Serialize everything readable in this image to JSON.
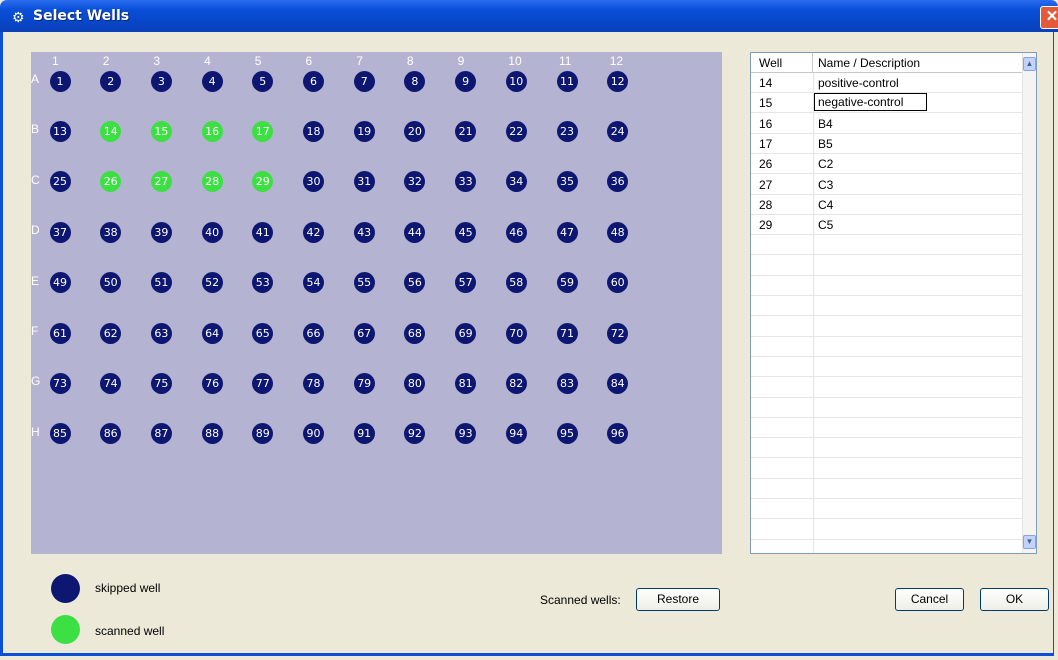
{
  "window": {
    "title": "Select Wells",
    "close_glyph": "✕"
  },
  "plate": {
    "columns": [
      "1",
      "2",
      "3",
      "4",
      "5",
      "6",
      "7",
      "8",
      "9",
      "10",
      "11",
      "12"
    ],
    "rows": [
      "A",
      "B",
      "C",
      "D",
      "E",
      "F",
      "G",
      "H"
    ],
    "scanned_wells": [
      14,
      15,
      16,
      17,
      26,
      27,
      28,
      29
    ],
    "colors": {
      "skipped": "#0D1671",
      "scanned": "#3CE043",
      "background": "#B4B4D2"
    }
  },
  "table": {
    "headers": {
      "well": "Well",
      "name": "Name / Description"
    },
    "rows": [
      {
        "well": "14",
        "name": "positive-control"
      },
      {
        "well": "15",
        "name": "negative-control",
        "editing": true
      },
      {
        "well": "16",
        "name": "B4"
      },
      {
        "well": "17",
        "name": "B5"
      },
      {
        "well": "26",
        "name": "C2"
      },
      {
        "well": "27",
        "name": "C3"
      },
      {
        "well": "28",
        "name": "C4"
      },
      {
        "well": "29",
        "name": "C5"
      }
    ]
  },
  "legend": {
    "skipped_label": "skipped well",
    "scanned_label": "scanned well"
  },
  "footer": {
    "scanned_wells_label": "Scanned wells:",
    "restore_label": "Restore",
    "cancel_label": "Cancel",
    "ok_label": "OK"
  },
  "icons": {
    "app": "app-icon",
    "up": "chevron-up-icon",
    "down": "chevron-down-icon"
  }
}
